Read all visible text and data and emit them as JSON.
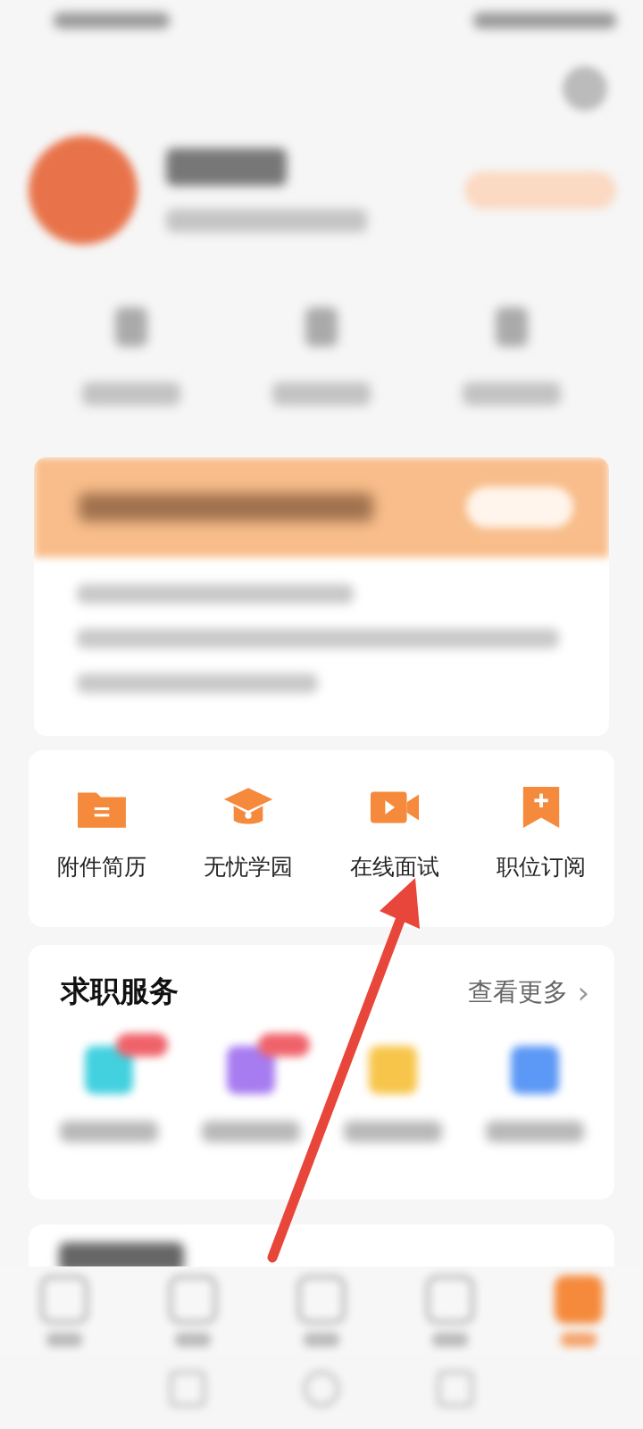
{
  "tools": [
    {
      "label": "附件简历"
    },
    {
      "label": "无忧学园"
    },
    {
      "label": "在线面试"
    },
    {
      "label": "职位订阅"
    }
  ],
  "job_services": {
    "title": "求职服务",
    "more_link": "查看更多",
    "more_arrow": "›"
  },
  "bottom_nav": [
    {
      "selected": false
    },
    {
      "selected": false
    },
    {
      "selected": false
    },
    {
      "selected": false
    },
    {
      "selected": true
    }
  ]
}
